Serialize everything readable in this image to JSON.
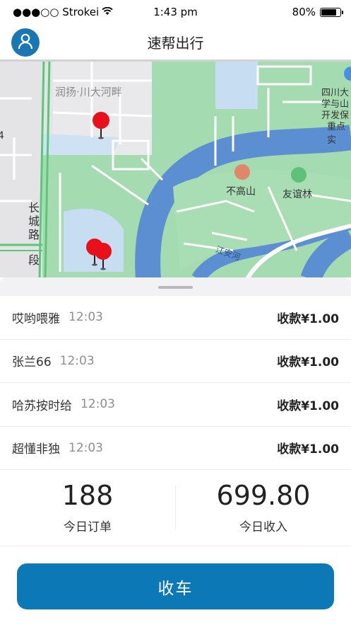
{
  "status_bar": {
    "carrier": "●●●○○ Strokei",
    "time": "1:43 pm",
    "battery_text": "80%",
    "battery_level": 0.8
  },
  "nav": {
    "title": "速帮出行",
    "avatar_icon": "user-icon"
  },
  "map": {
    "labels": {
      "area_top_left": "润扬·川大河畔",
      "road_vertical": "长城路",
      "road_segment": "段",
      "poi_1": "不高山",
      "poi_2": "友谊林",
      "river": "江安河",
      "uni_1": "四川大",
      "uni_2": "学与山",
      "uni_3": "开发保",
      "uni_4": "重点实",
      "edge_number": "4"
    },
    "pin_color": "#e8101a"
  },
  "orders": [
    {
      "name": "哎哟喂雅",
      "time": "12:03",
      "amount": "收款¥1.00"
    },
    {
      "name": "张兰66",
      "time": "12:03",
      "amount": "收款¥1.00"
    },
    {
      "name": "哈苏按时给",
      "time": "12:03",
      "amount": "收款¥1.00"
    },
    {
      "name": "超懂非独",
      "time": "12:03",
      "amount": "收款¥1.00"
    }
  ],
  "stats": {
    "orders_value": "188",
    "orders_label": "今日订单",
    "income_value": "699.80",
    "income_label": "今日收入"
  },
  "action": {
    "label": "收车"
  },
  "colors": {
    "accent": "#0c78b6",
    "map_green": "#9fd6a8",
    "map_water": "#5b8fd1"
  }
}
